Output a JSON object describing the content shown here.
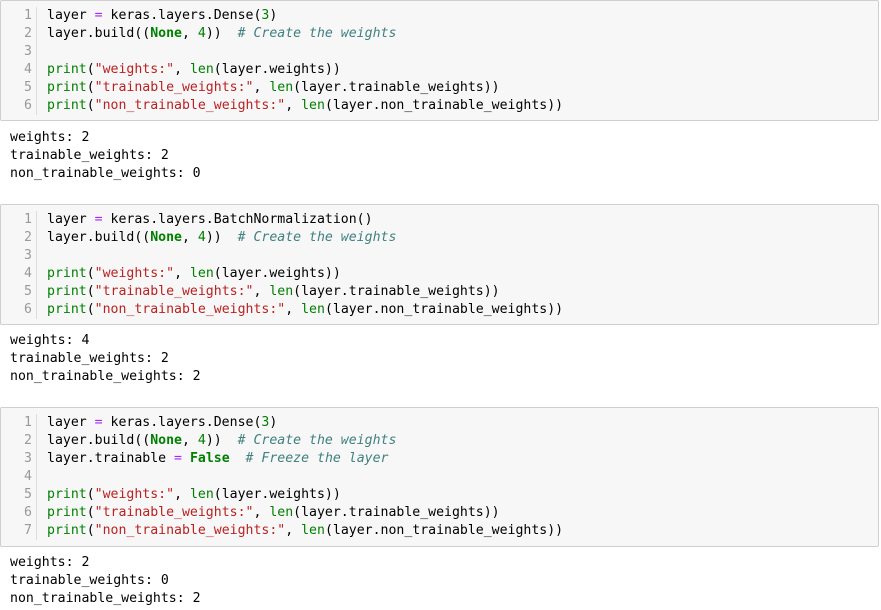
{
  "cells": [
    {
      "code": [
        {
          "n": "1",
          "tokens": [
            [
              "",
              "layer "
            ],
            [
              "op",
              "="
            ],
            [
              "",
              " keras.layers.Dense("
            ],
            [
              "num",
              "3"
            ],
            [
              "",
              ")"
            ]
          ]
        },
        {
          "n": "2",
          "tokens": [
            [
              "",
              "layer.build(("
            ],
            [
              "kw",
              "None"
            ],
            [
              "",
              ", "
            ],
            [
              "num",
              "4"
            ],
            [
              "",
              "))  "
            ],
            [
              "cm",
              "# Create the weights"
            ]
          ]
        },
        {
          "n": "3",
          "tokens": []
        },
        {
          "n": "4",
          "tokens": [
            [
              "bi",
              "print"
            ],
            [
              "",
              "("
            ],
            [
              "str",
              "\"weights:\""
            ],
            [
              "",
              ", "
            ],
            [
              "bi",
              "len"
            ],
            [
              "",
              "(layer.weights))"
            ]
          ]
        },
        {
          "n": "5",
          "tokens": [
            [
              "bi",
              "print"
            ],
            [
              "",
              "("
            ],
            [
              "str",
              "\"trainable_weights:\""
            ],
            [
              "",
              ", "
            ],
            [
              "bi",
              "len"
            ],
            [
              "",
              "(layer.trainable_weights))"
            ]
          ]
        },
        {
          "n": "6",
          "tokens": [
            [
              "bi",
              "print"
            ],
            [
              "",
              "("
            ],
            [
              "str",
              "\"non_trainable_weights:\""
            ],
            [
              "",
              ", "
            ],
            [
              "bi",
              "len"
            ],
            [
              "",
              "(layer.non_trainable_weights))"
            ]
          ]
        }
      ],
      "output": [
        "weights: 2",
        "trainable_weights: 2",
        "non_trainable_weights: 0"
      ]
    },
    {
      "code": [
        {
          "n": "1",
          "tokens": [
            [
              "",
              "layer "
            ],
            [
              "op",
              "="
            ],
            [
              "",
              " keras.layers.BatchNormalization()"
            ]
          ]
        },
        {
          "n": "2",
          "tokens": [
            [
              "",
              "layer.build(("
            ],
            [
              "kw",
              "None"
            ],
            [
              "",
              ", "
            ],
            [
              "num",
              "4"
            ],
            [
              "",
              "))  "
            ],
            [
              "cm",
              "# Create the weights"
            ]
          ]
        },
        {
          "n": "3",
          "tokens": []
        },
        {
          "n": "4",
          "tokens": [
            [
              "bi",
              "print"
            ],
            [
              "",
              "("
            ],
            [
              "str",
              "\"weights:\""
            ],
            [
              "",
              ", "
            ],
            [
              "bi",
              "len"
            ],
            [
              "",
              "(layer.weights))"
            ]
          ]
        },
        {
          "n": "5",
          "tokens": [
            [
              "bi",
              "print"
            ],
            [
              "",
              "("
            ],
            [
              "str",
              "\"trainable_weights:\""
            ],
            [
              "",
              ", "
            ],
            [
              "bi",
              "len"
            ],
            [
              "",
              "(layer.trainable_weights))"
            ]
          ]
        },
        {
          "n": "6",
          "tokens": [
            [
              "bi",
              "print"
            ],
            [
              "",
              "("
            ],
            [
              "str",
              "\"non_trainable_weights:\""
            ],
            [
              "",
              ", "
            ],
            [
              "bi",
              "len"
            ],
            [
              "",
              "(layer.non_trainable_weights))"
            ]
          ]
        }
      ],
      "output": [
        "weights: 4",
        "trainable_weights: 2",
        "non_trainable_weights: 2"
      ]
    },
    {
      "code": [
        {
          "n": "1",
          "tokens": [
            [
              "",
              "layer "
            ],
            [
              "op",
              "="
            ],
            [
              "",
              " keras.layers.Dense("
            ],
            [
              "num",
              "3"
            ],
            [
              "",
              ")"
            ]
          ]
        },
        {
          "n": "2",
          "tokens": [
            [
              "",
              "layer.build(("
            ],
            [
              "kw",
              "None"
            ],
            [
              "",
              ", "
            ],
            [
              "num",
              "4"
            ],
            [
              "",
              "))  "
            ],
            [
              "cm",
              "# Create the weights"
            ]
          ]
        },
        {
          "n": "3",
          "tokens": [
            [
              "",
              "layer.trainable "
            ],
            [
              "op",
              "="
            ],
            [
              "",
              " "
            ],
            [
              "kw",
              "False"
            ],
            [
              "",
              "  "
            ],
            [
              "cm",
              "# Freeze the layer"
            ]
          ]
        },
        {
          "n": "4",
          "tokens": []
        },
        {
          "n": "5",
          "tokens": [
            [
              "bi",
              "print"
            ],
            [
              "",
              "("
            ],
            [
              "str",
              "\"weights:\""
            ],
            [
              "",
              ", "
            ],
            [
              "bi",
              "len"
            ],
            [
              "",
              "(layer.weights))"
            ]
          ]
        },
        {
          "n": "6",
          "tokens": [
            [
              "bi",
              "print"
            ],
            [
              "",
              "("
            ],
            [
              "str",
              "\"trainable_weights:\""
            ],
            [
              "",
              ", "
            ],
            [
              "bi",
              "len"
            ],
            [
              "",
              "(layer.trainable_weights))"
            ]
          ]
        },
        {
          "n": "7",
          "tokens": [
            [
              "bi",
              "print"
            ],
            [
              "",
              "("
            ],
            [
              "str",
              "\"non_trainable_weights:\""
            ],
            [
              "",
              ", "
            ],
            [
              "bi",
              "len"
            ],
            [
              "",
              "(layer.non_trainable_weights))"
            ]
          ]
        }
      ],
      "output": [
        "weights: 2",
        "trainable_weights: 0",
        "non_trainable_weights: 2"
      ]
    }
  ]
}
